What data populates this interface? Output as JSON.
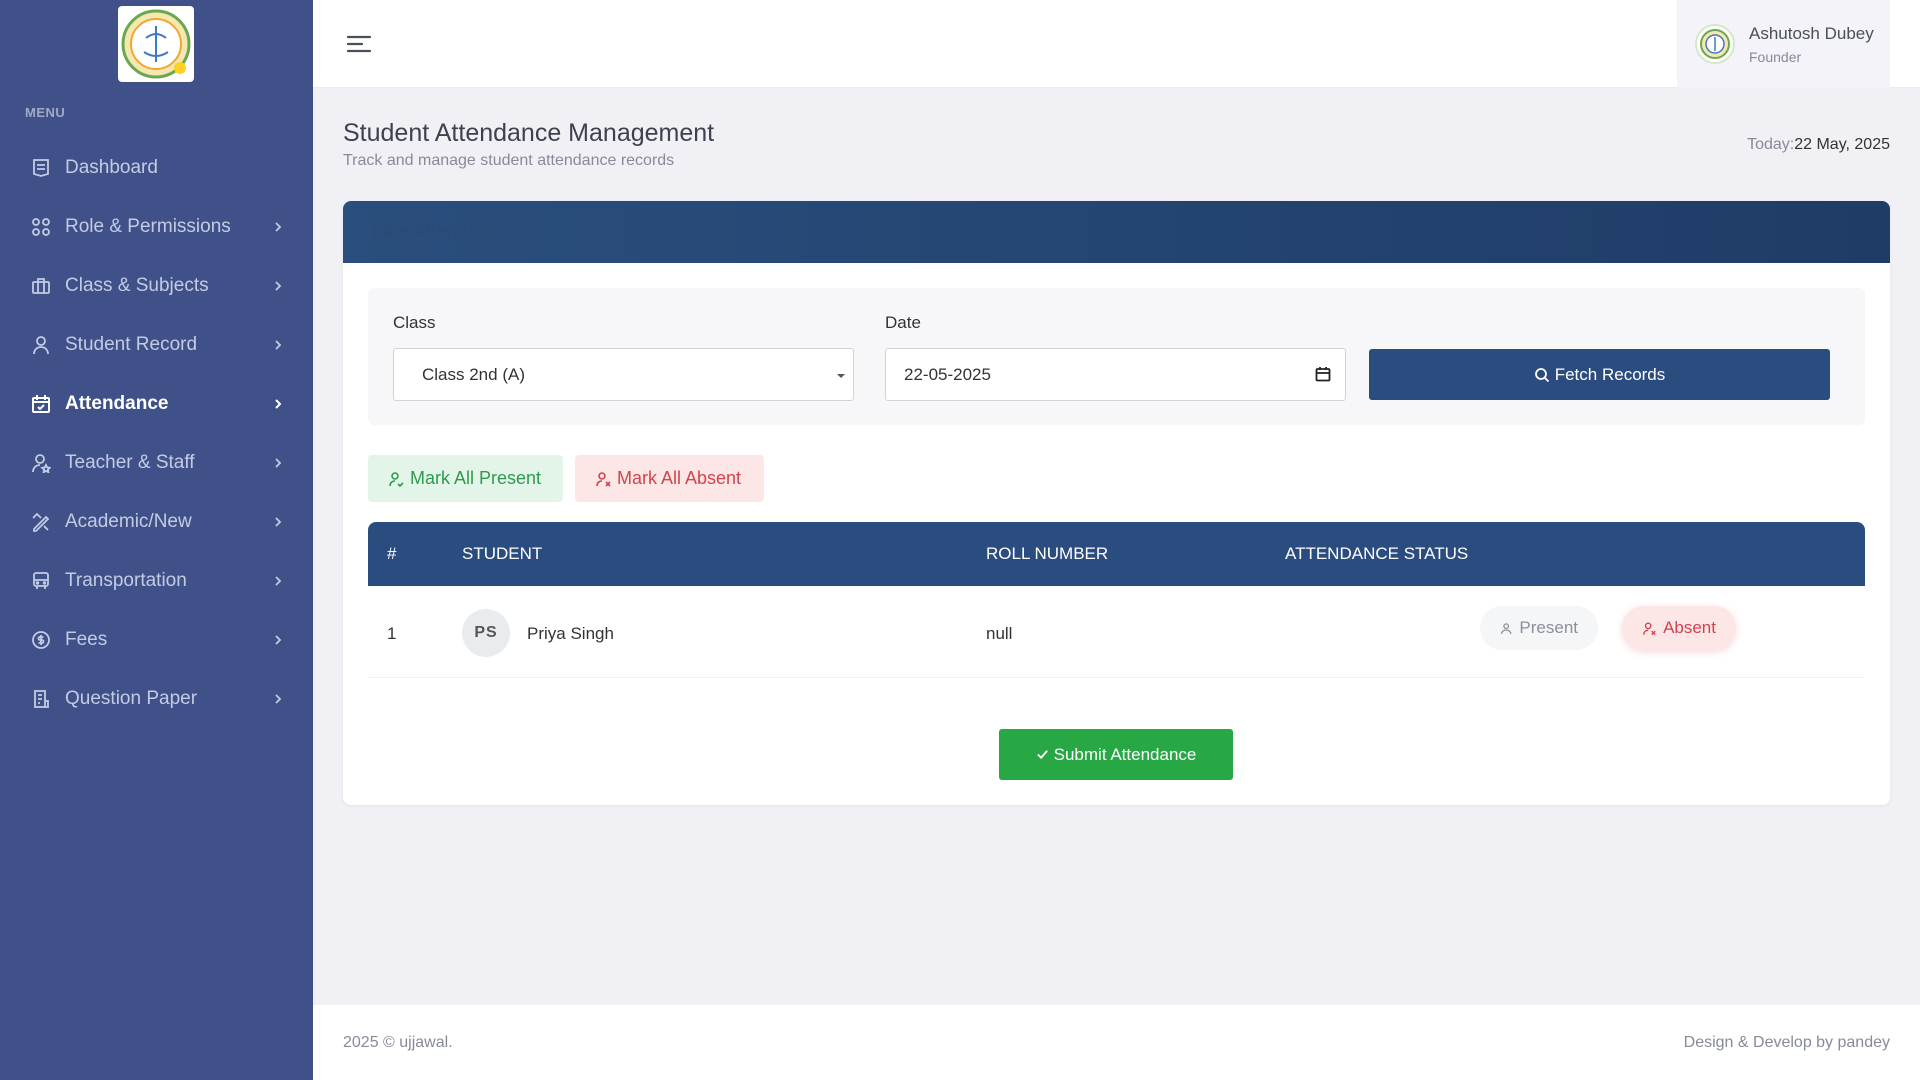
{
  "sidebar": {
    "menu_title": "MENU",
    "items": [
      {
        "label": "Dashboard",
        "icon": "dashboard-icon",
        "has_chevron": false
      },
      {
        "label": "Role & Permissions",
        "icon": "grid-icon",
        "has_chevron": true
      },
      {
        "label": "Class & Subjects",
        "icon": "briefcase-icon",
        "has_chevron": true
      },
      {
        "label": "Student Record",
        "icon": "user-icon",
        "has_chevron": true
      },
      {
        "label": "Attendance",
        "icon": "calendar-check-icon",
        "has_chevron": true,
        "active": true
      },
      {
        "label": "Teacher & Staff",
        "icon": "user-star-icon",
        "has_chevron": true
      },
      {
        "label": "Academic/New",
        "icon": "pencil-ruler-icon",
        "has_chevron": true
      },
      {
        "label": "Transportation",
        "icon": "bus-icon",
        "has_chevron": true
      },
      {
        "label": "Fees",
        "icon": "money-icon",
        "has_chevron": true
      },
      {
        "label": "Question Paper",
        "icon": "file-list-icon",
        "has_chevron": true
      }
    ]
  },
  "user": {
    "name": "Ashutosh Dubey",
    "role": "Founder"
  },
  "page": {
    "title": "Student Attendance Management",
    "subtitle": "Track and manage student attendance records",
    "today_label": "Today:",
    "today_value": "22 May, 2025"
  },
  "card": {
    "title": "Take Attendance",
    "class_label": "Class",
    "class_value": "Class 2nd (A)",
    "date_label": "Date",
    "date_value": "22-05-2025",
    "fetch_label": "Fetch Records",
    "mark_all_present": "Mark All Present",
    "mark_all_absent": "Mark All Absent",
    "submit_label": "Submit Attendance"
  },
  "table": {
    "headers": {
      "num": "#",
      "student": "STUDENT",
      "roll": "ROLL NUMBER",
      "status": "ATTENDANCE STATUS"
    },
    "rows": [
      {
        "num": "1",
        "initials": "PS",
        "name": "Priya Singh",
        "roll": "null",
        "present_label": "Present",
        "absent_label": "Absent",
        "selected": "Absent"
      }
    ]
  },
  "footer": {
    "left": "2025 © ujjawal.",
    "right": "Design & Develop by pandey"
  },
  "colors": {
    "sidebar": "#405189",
    "primary": "#2b4c7e",
    "success": "#28a745",
    "danger": "#d1434f"
  }
}
